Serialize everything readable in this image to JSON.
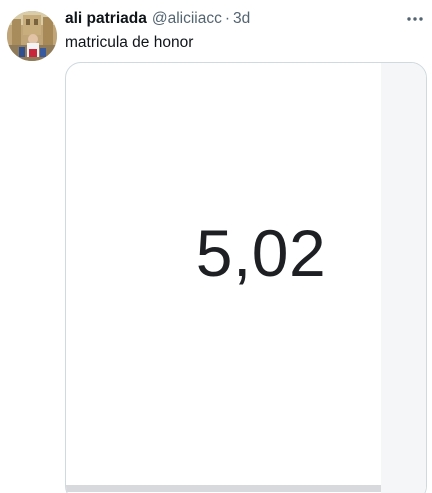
{
  "tweet": {
    "avatar_icon": "profile-photo",
    "display_name": "ali patriada",
    "handle": "@aliciiacc",
    "separator": "·",
    "timestamp": "3d",
    "more_icon": "more-horizontal-icon",
    "text": "matricula de honor"
  },
  "media": {
    "grade_value": "5,02"
  },
  "colors": {
    "text_primary": "#0f1419",
    "text_secondary": "#536471",
    "border": "#cfd9de"
  }
}
